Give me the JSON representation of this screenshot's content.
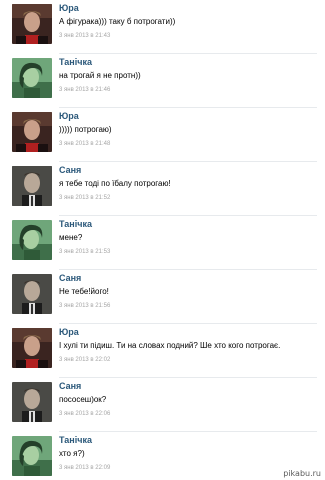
{
  "messages": [
    {
      "author": "Юра",
      "avatar": "yura",
      "text": "А фігурака))) таку б потрогати))",
      "date": "3 янв 2013 в 21:43"
    },
    {
      "author": "Танічка",
      "avatar": "tanichka",
      "text": "на трогай я не протн))",
      "date": "3 янв 2013 в 21:46"
    },
    {
      "author": "Юра",
      "avatar": "yura",
      "text": "))))) потрогаю)",
      "date": "3 янв 2013 в 21:48"
    },
    {
      "author": "Саня",
      "avatar": "sanya",
      "text": "я тебе тоді по їбалу потрогаю!",
      "date": "3 янв 2013 в 21:52"
    },
    {
      "author": "Танічка",
      "avatar": "tanichka",
      "text": "мене?",
      "date": "3 янв 2013 в 21:53"
    },
    {
      "author": "Саня",
      "avatar": "sanya",
      "text": "Не тебе!його!",
      "date": "3 янв 2013 в 21:56"
    },
    {
      "author": "Юра",
      "avatar": "yura",
      "text": "І хулі ти підиш. Ти на словах подний? Ше хто кого потрогає.",
      "date": "3 янв 2013 в 22:02"
    },
    {
      "author": "Саня",
      "avatar": "sanya",
      "text": "пососеш)ок?",
      "date": "3 янв 2013 в 22:06"
    },
    {
      "author": "Танічка",
      "avatar": "tanichka",
      "text": "хто я?)",
      "date": "3 янв 2013 в 22:09"
    }
  ],
  "watermark": "pikabu.ru",
  "colors": {
    "author_link": "#2b587a",
    "date": "#a6a6a6",
    "separator": "#e7eaed",
    "avatar_yura_bg": "#3a2420",
    "avatar_tanichka_bg": "#6fa67a",
    "avatar_sanya_bg": "#2e2e2e"
  }
}
